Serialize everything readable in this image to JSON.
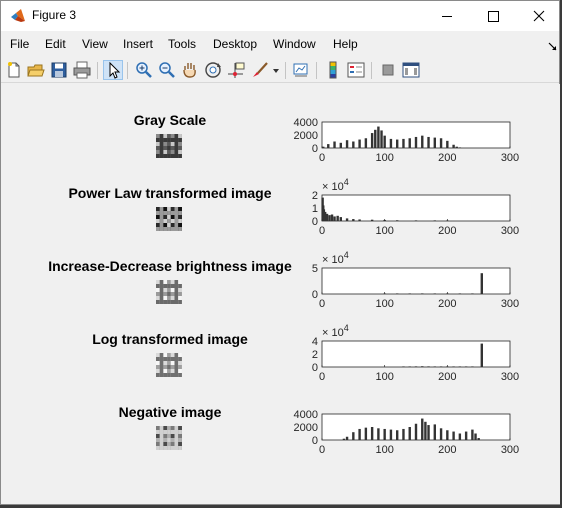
{
  "window": {
    "title": "Figure 3",
    "controls": {
      "minimize": "minimize-icon",
      "maximize": "maximize-icon",
      "close": "close-icon"
    }
  },
  "menu": [
    "File",
    "Edit",
    "View",
    "Insert",
    "Tools",
    "Desktop",
    "Window",
    "Help"
  ],
  "toolbar": {
    "icons": [
      "new-figure-icon",
      "open-file-icon",
      "save-icon",
      "print-icon",
      "pointer-icon",
      "zoom-in-icon",
      "zoom-out-icon",
      "pan-icon",
      "rotate-3d-icon",
      "data-cursor-icon",
      "brush-icon",
      "link-plot-icon",
      "colorbar-icon",
      "legend-icon",
      "hide-plot-tools-icon",
      "show-plot-tools-icon"
    ]
  },
  "rows": [
    {
      "title": "Gray Scale"
    },
    {
      "title": "Power Law transformed image"
    },
    {
      "title": "Increase-Decrease brightness image"
    },
    {
      "title": "Log transformed image"
    },
    {
      "title": "Negative image"
    }
  ],
  "chart_data": [
    {
      "type": "bar",
      "xlim": [
        0,
        300
      ],
      "xticks": [
        "0",
        "100",
        "200",
        "300"
      ],
      "ylim": [
        0,
        4000
      ],
      "yticks": [
        "0",
        "2000",
        "4000"
      ],
      "exponent": "",
      "bar_color": "#333333",
      "x": [
        2,
        10,
        20,
        30,
        40,
        50,
        60,
        70,
        80,
        85,
        90,
        95,
        100,
        110,
        120,
        130,
        140,
        150,
        160,
        170,
        180,
        190,
        200,
        210,
        215,
        220
      ],
      "values": [
        200,
        600,
        1000,
        800,
        1200,
        1000,
        1300,
        1500,
        2300,
        2800,
        3300,
        2700,
        1900,
        1400,
        1300,
        1400,
        1500,
        1700,
        1900,
        1700,
        1600,
        1500,
        1100,
        500,
        200,
        50
      ]
    },
    {
      "type": "bar",
      "xlim": [
        0,
        300
      ],
      "xticks": [
        "0",
        "100",
        "200",
        "300"
      ],
      "ylim": [
        0,
        2
      ],
      "yticks": [
        "0",
        "1",
        "2"
      ],
      "exponent": "4",
      "bar_color": "#333333",
      "x": [
        1,
        2,
        3,
        5,
        8,
        12,
        16,
        20,
        25,
        30,
        40,
        50,
        60,
        80,
        100,
        120,
        150,
        180,
        200
      ],
      "values": [
        1.8,
        1.2,
        0.9,
        0.7,
        0.55,
        0.45,
        0.5,
        0.35,
        0.4,
        0.3,
        0.2,
        0.15,
        0.12,
        0.1,
        0.08,
        0.06,
        0.05,
        0.05,
        0.04
      ]
    },
    {
      "type": "bar",
      "xlim": [
        0,
        300
      ],
      "xticks": [
        "0",
        "100",
        "200",
        "300"
      ],
      "ylim": [
        0,
        5
      ],
      "yticks": [
        "0",
        "5"
      ],
      "exponent": "4",
      "bar_color": "#333333",
      "x": [
        100,
        120,
        140,
        160,
        180,
        200,
        220,
        240,
        255
      ],
      "values": [
        0.05,
        0.08,
        0.1,
        0.12,
        0.1,
        0.08,
        0.06,
        0.05,
        4.0
      ]
    },
    {
      "type": "bar",
      "xlim": [
        0,
        300
      ],
      "xticks": [
        "0",
        "100",
        "200",
        "300"
      ],
      "ylim": [
        0,
        4
      ],
      "yticks": [
        "0",
        "2",
        "4"
      ],
      "exponent": "4",
      "bar_color": "#333333",
      "x": [
        130,
        140,
        150,
        160,
        170,
        180,
        190,
        200,
        210,
        220,
        230,
        240,
        255
      ],
      "values": [
        0.06,
        0.08,
        0.1,
        0.12,
        0.1,
        0.08,
        0.06,
        0.05,
        0.05,
        0.06,
        0.06,
        0.05,
        3.6
      ]
    },
    {
      "type": "bar",
      "xlim": [
        0,
        300
      ],
      "xticks": [
        "0",
        "100",
        "200",
        "300"
      ],
      "ylim": [
        0,
        4000
      ],
      "yticks": [
        "0",
        "2000",
        "4000"
      ],
      "exponent": "",
      "bar_color": "#333333",
      "x": [
        35,
        40,
        50,
        60,
        70,
        80,
        90,
        100,
        110,
        120,
        130,
        140,
        150,
        160,
        165,
        170,
        180,
        190,
        200,
        210,
        220,
        230,
        240,
        245,
        250
      ],
      "values": [
        200,
        500,
        1200,
        1700,
        1900,
        2000,
        1800,
        1700,
        1600,
        1500,
        1700,
        2000,
        2500,
        3300,
        2800,
        2300,
        2400,
        1800,
        1500,
        1300,
        1000,
        1300,
        1600,
        1000,
        300
      ]
    }
  ]
}
